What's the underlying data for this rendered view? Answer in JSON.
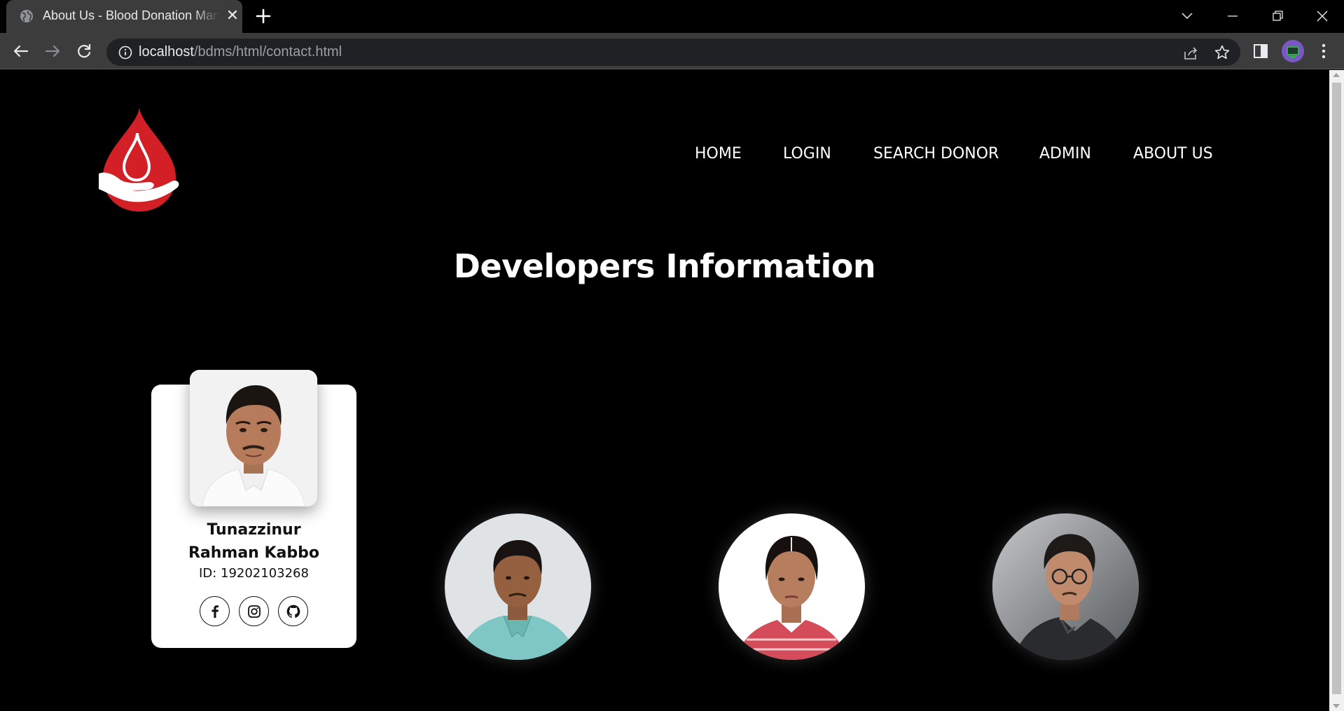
{
  "browser": {
    "tab_title": "About Us - Blood Donation Management System",
    "tab_favicon": "globe-icon",
    "url_host": "localhost",
    "url_path": "/bdms/html/contact.html"
  },
  "nav": {
    "items": [
      {
        "label": "HOME"
      },
      {
        "label": "LOGIN"
      },
      {
        "label": "SEARCH DONOR"
      },
      {
        "label": "ADMIN"
      },
      {
        "label": "ABOUT US"
      }
    ]
  },
  "page": {
    "heading": "Developers Information",
    "logo": "blood-drop-hand-icon",
    "accent_color": "#d32027"
  },
  "developers": [
    {
      "name_line1": "Tunazzinur",
      "name_line2": "Rahman Kabbo",
      "id_text": "ID: 19202103268",
      "socials": [
        "facebook-icon",
        "instagram-icon",
        "github-icon"
      ]
    },
    {
      "photo": "developer-2-photo"
    },
    {
      "photo": "developer-3-photo"
    },
    {
      "photo": "developer-4-photo"
    }
  ]
}
